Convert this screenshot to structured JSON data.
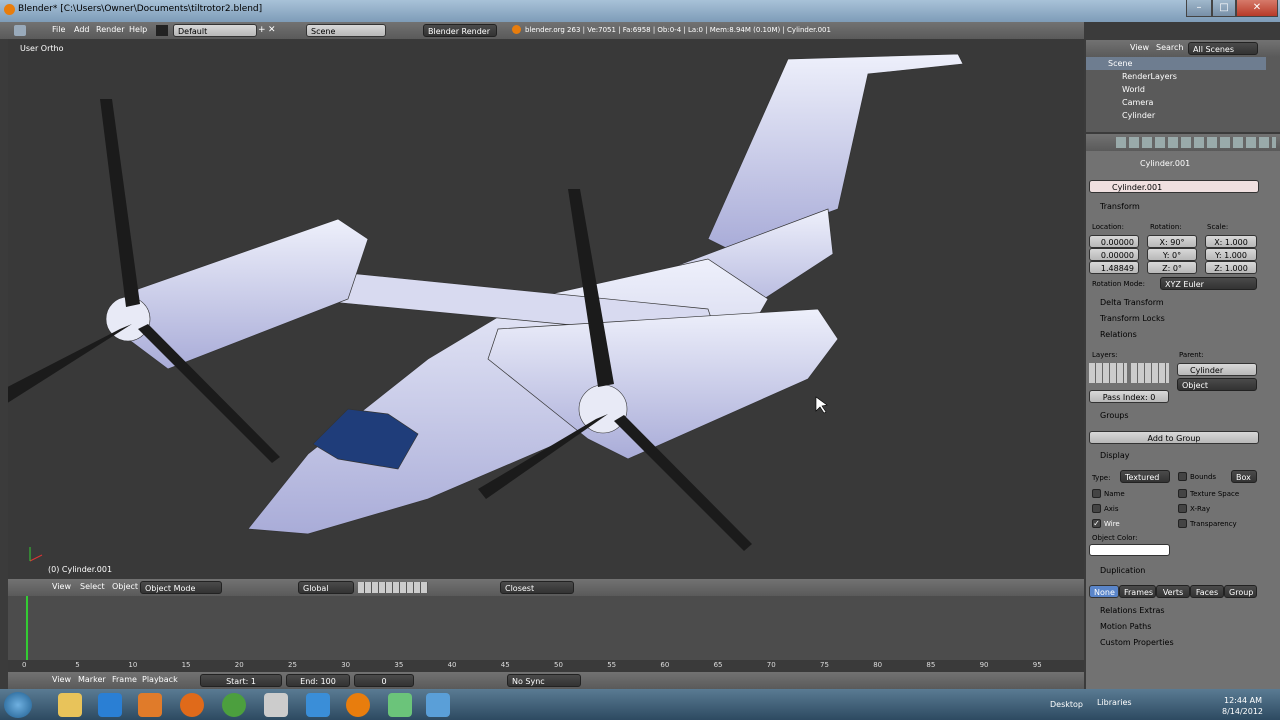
{
  "window": {
    "title": "Blender* [C:\\Users\\Owner\\Documents\\tiltrotor2.blend]",
    "buttons": [
      "–",
      "□",
      "✕"
    ]
  },
  "menubar": {
    "menus": [
      "File",
      "Add",
      "Render",
      "Help"
    ],
    "layout": "Default",
    "scene": "Scene",
    "engine": "Blender Render",
    "stats": "blender.org 263 | Ve:7051 | Fa:6958 | Ob:0-4 | La:0 | Mem:8.94M (0.10M) | Cylinder.001"
  },
  "viewport": {
    "view_label": "User Ortho",
    "object_label": "(0) Cylinder.001"
  },
  "view3d_header": {
    "menus": [
      "View",
      "Select",
      "Object"
    ],
    "mode": "Object Mode",
    "orientation": "Global",
    "snap": "Closest"
  },
  "timeline": {
    "ticks": [
      "0",
      "5",
      "10",
      "15",
      "20",
      "25",
      "30",
      "35",
      "40",
      "45",
      "50",
      "55",
      "60",
      "65",
      "70",
      "75",
      "80",
      "85",
      "90",
      "95"
    ],
    "current_frame_pct": 0,
    "menus": [
      "View",
      "Marker",
      "Frame",
      "Playback"
    ],
    "start": "Start: 1",
    "end": "End: 100",
    "current": "0",
    "sync": "No Sync"
  },
  "outliner": {
    "menus": [
      "View",
      "Search"
    ],
    "filter": "All Scenes",
    "items": [
      "Scene",
      "RenderLayers",
      "World",
      "Camera",
      "Cylinder"
    ]
  },
  "properties": {
    "breadcrumb": "Cylinder.001",
    "object_name": "Cylinder.001",
    "transform": {
      "title": "Transform",
      "location_label": "Location:",
      "rotation_label": "Rotation:",
      "scale_label": "Scale:",
      "location": [
        "0.00000",
        "0.00000",
        "1.48849"
      ],
      "rotation": [
        "X: 90°",
        "Y: 0°",
        "Z: 0°"
      ],
      "scale": [
        "X: 1.000",
        "Y: 1.000",
        "Z: 1.000"
      ],
      "rotation_mode_label": "Rotation Mode:",
      "rotation_mode": "XYZ Euler"
    },
    "delta_transform": "Delta Transform",
    "transform_locks": "Transform Locks",
    "relations": {
      "title": "Relations",
      "layers_label": "Layers:",
      "parent_label": "Parent:",
      "parent": "Cylinder",
      "parent_type": "Object",
      "pass_index": "Pass Index: 0"
    },
    "groups": {
      "title": "Groups",
      "add_button": "Add to Group"
    },
    "display": {
      "title": "Display",
      "type_label": "Type:",
      "type": "Textured",
      "bounds_label": "Bounds",
      "bounds_type": "Box",
      "name": "Name",
      "texture_space": "Texture Space",
      "axis": "Axis",
      "xray": "X-Ray",
      "wire": "Wire",
      "transparency": "Transparency",
      "object_color_label": "Object Color:"
    },
    "duplication": {
      "title": "Duplication",
      "options": [
        "None",
        "Frames",
        "Verts",
        "Faces",
        "Group"
      ]
    },
    "relations_extras": "Relations Extras",
    "motion_paths": "Motion Paths",
    "custom_properties": "Custom Properties"
  },
  "taskbar": {
    "desktop": "Desktop",
    "libraries": "Libraries",
    "time": "12:44 AM",
    "date": "8/14/2012"
  }
}
